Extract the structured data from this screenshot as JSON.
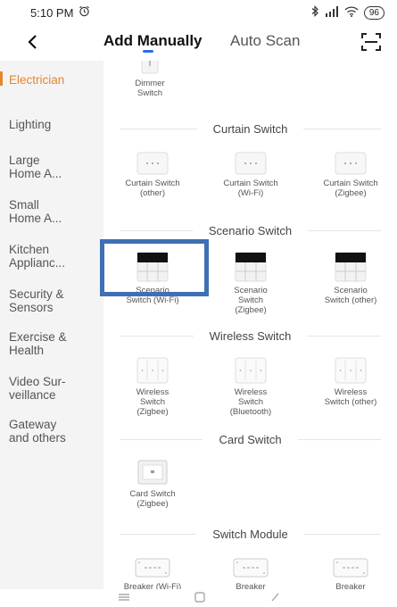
{
  "status": {
    "time": "5:10 PM",
    "battery": "96"
  },
  "header": {
    "tab_active": "Add Manually",
    "tab_inactive": "Auto Scan"
  },
  "sidebar": {
    "items": [
      {
        "label": "Electrician"
      },
      {
        "label": "Lighting"
      },
      {
        "label": "Large\nHome A..."
      },
      {
        "label": "Small\nHome A..."
      },
      {
        "label": "Kitchen\nApplianc..."
      },
      {
        "label": "Security &\nSensors"
      },
      {
        "label": "Exercise &\nHealth"
      },
      {
        "label": "Video Sur-\nveillance"
      },
      {
        "label": "Gateway\nand others"
      }
    ]
  },
  "content": {
    "top_item": {
      "label": "Dimmer\nSwitch"
    },
    "sections": [
      {
        "title": "Curtain Switch",
        "items": [
          {
            "label": "Curtain Switch\n(other)"
          },
          {
            "label": "Curtain Switch\n(Wi-Fi)"
          },
          {
            "label": "Curtain Switch\n(Zigbee)"
          }
        ]
      },
      {
        "title": "Scenario Switch",
        "items": [
          {
            "label": "Scenario\nSwitch (Wi-Fi)"
          },
          {
            "label": "Scenario\nSwitch\n(Zigbee)"
          },
          {
            "label": "Scenario\nSwitch (other)"
          }
        ]
      },
      {
        "title": "Wireless Switch",
        "items": [
          {
            "label": "Wireless\nSwitch\n(Zigbee)"
          },
          {
            "label": "Wireless\nSwitch\n(Bluetooth)"
          },
          {
            "label": "Wireless\nSwitch (other)"
          }
        ]
      },
      {
        "title": "Card Switch",
        "items": [
          {
            "label": "Card Switch\n(Zigbee)"
          }
        ]
      },
      {
        "title": "Switch Module",
        "items": [
          {
            "label": "Breaker (Wi-Fi)"
          },
          {
            "label": "Breaker"
          },
          {
            "label": "Breaker"
          }
        ]
      }
    ]
  },
  "colors": {
    "accent": "#e6872a",
    "highlight": "#3f6fb5",
    "sidebar_bg": "#f4f4f5"
  }
}
